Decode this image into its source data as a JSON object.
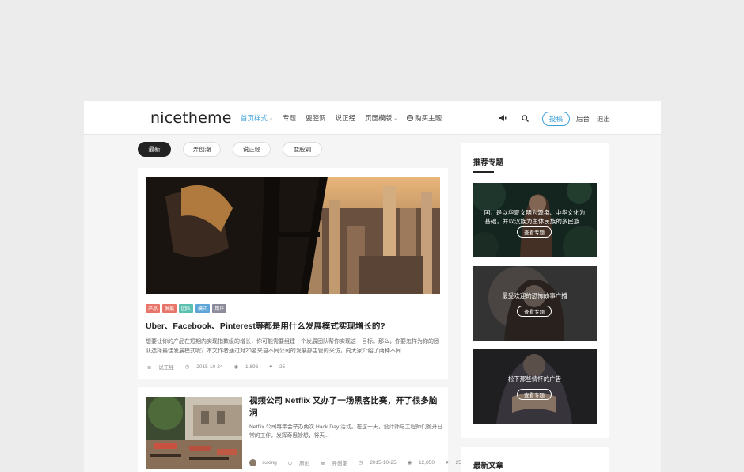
{
  "header": {
    "logo": "nicetheme",
    "nav": [
      {
        "label": "首页样式",
        "active": true,
        "chevron": true
      },
      {
        "label": "专题",
        "active": false,
        "chevron": false
      },
      {
        "label": "耍腔调",
        "active": false,
        "chevron": false
      },
      {
        "label": "说正经",
        "active": false,
        "chevron": false
      },
      {
        "label": "页面模版",
        "active": false,
        "chevron": true
      },
      {
        "label": "购买主题",
        "active": false,
        "chevron": false,
        "icon": "wordpress-icon"
      }
    ],
    "submit_label": "投稿",
    "admin_label": "后台",
    "logout_label": "退出",
    "accent": "#3aa0d8"
  },
  "tabs": [
    {
      "label": "最新",
      "active": true
    },
    {
      "label": "弄创潮",
      "active": false
    },
    {
      "label": "说正经",
      "active": false
    },
    {
      "label": "耍腔调",
      "active": false
    }
  ],
  "post1": {
    "tags": [
      {
        "label": "产品",
        "color": "#e8756a"
      },
      {
        "label": "发展",
        "color": "#e8756a"
      },
      {
        "label": "团队",
        "color": "#5bc0b0"
      },
      {
        "label": "模式",
        "color": "#5fa6d8"
      },
      {
        "label": "用户",
        "color": "#8c8c9c"
      }
    ],
    "title": "Uber、Facebook、Pinterest等都是用什么发展模式实现增长的?",
    "excerpt": "想要让你的产品在短期内实现指数级的增长，你可能需要组建一个发展团队帮你实现这一目标。那么，你要怎样为你的团队选择最佳发展模式呢？本文作者通过对20名来自不同公司的发展部主管的采访，向大家介绍了两种不同...",
    "category": "说正经",
    "date": "2015-10-24",
    "views": "1,896",
    "likes": "25"
  },
  "post2": {
    "title": "视频公司 Netflix 又办了一场黑客比赛，开了很多脑洞",
    "excerpt": "Netflix 公司每年会举办两次 Hack Day 活动。在这一天，设计师与工程师们抛开日常的工作，发挥奇思妙想，将天...",
    "author": "suxing",
    "type": "原创",
    "category": "弄创潮",
    "date": "2015-10-25",
    "views": "12,850",
    "likes": "252"
  },
  "sidebar": {
    "title": "推荐专题",
    "topics": [
      {
        "text": "国，是以华夏文明为源泉、中华文化为基础，并以汉族为主体民族的多民族...",
        "button": "查看专题"
      },
      {
        "text": "最受欢迎的恐怖故事广播",
        "button": "查看专题"
      },
      {
        "text": "松下那些情怀的广告",
        "button": "查看专题"
      }
    ],
    "latest_title": "最新文章"
  }
}
